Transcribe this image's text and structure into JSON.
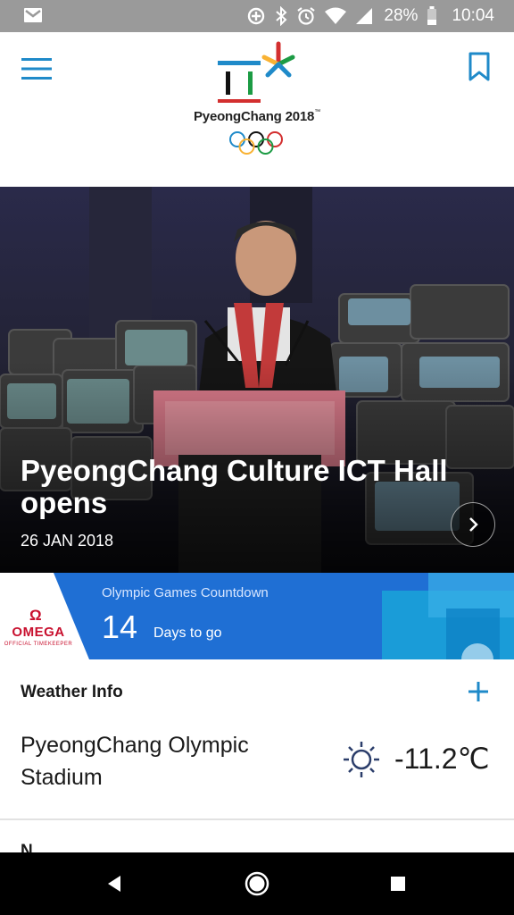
{
  "status_bar": {
    "battery": "28%",
    "time": "10:04",
    "icons": [
      "gmail-icon",
      "data-saver-icon",
      "bluetooth-icon",
      "alarm-icon",
      "wifi-icon",
      "signal-icon",
      "battery-icon"
    ]
  },
  "header": {
    "logo_text": "PyeongChang 2018",
    "logo_tm": "™",
    "icons": [
      "menu-icon",
      "bookmark-icon"
    ]
  },
  "hero": {
    "title": "PyeongChang Culture ICT Hall opens",
    "date": "26 JAN 2018",
    "icons": [
      "chevron-right-icon"
    ]
  },
  "countdown": {
    "sponsor_symbol": "Ω",
    "sponsor_name": "OMEGA",
    "sponsor_sub": "OFFICIAL TIMEKEEPER",
    "label": "Olympic Games Countdown",
    "days": "14",
    "days_label": "Days to go",
    "color": "#1f6fd4"
  },
  "weather": {
    "title": "Weather Info",
    "place": "PyeongChang Olympic Stadium",
    "temp": "-11.2℃",
    "icons": [
      "plus-icon",
      "sun-icon"
    ]
  },
  "next_section": {
    "label": "N"
  },
  "navbar": {
    "icons": [
      "back-icon",
      "home-icon",
      "recents-icon"
    ]
  }
}
